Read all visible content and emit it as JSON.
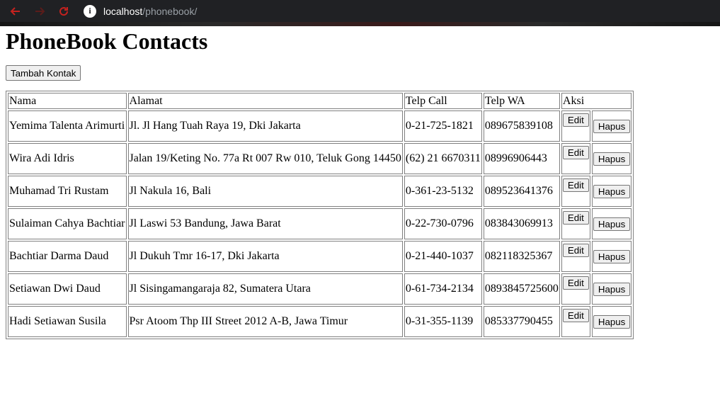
{
  "browser": {
    "url_host": "localhost",
    "url_path": "/phonebook/"
  },
  "page": {
    "title": "PhoneBook Contacts",
    "add_button": "Tambah Kontak"
  },
  "table": {
    "headers": [
      "Nama",
      "Alamat",
      "Telp Call",
      "Telp WA",
      "Aksi"
    ],
    "edit_label": "Edit",
    "delete_label": "Hapus",
    "rows": [
      {
        "nama": "Yemima Talenta Arimurti",
        "alamat": "Jl. Jl Hang Tuah Raya 19, Dki Jakarta",
        "telp_call": "0-21-725-1821",
        "telp_wa": "089675839108"
      },
      {
        "nama": "Wira Adi Idris",
        "alamat": "Jalan 19/Keting No. 77a Rt 007 Rw 010, Teluk Gong 14450",
        "telp_call": "(62) 21 6670311",
        "telp_wa": "08996906443"
      },
      {
        "nama": "Muhamad Tri Rustam",
        "alamat": "Jl Nakula 16, Bali",
        "telp_call": "0-361-23-5132",
        "telp_wa": "089523641376"
      },
      {
        "nama": "Sulaiman Cahya Bachtiar",
        "alamat": "Jl Laswi 53 Bandung, Jawa Barat",
        "telp_call": "0-22-730-0796",
        "telp_wa": "083843069913"
      },
      {
        "nama": "Bachtiar Darma Daud",
        "alamat": "Jl Dukuh Tmr 16-17, Dki Jakarta",
        "telp_call": "0-21-440-1037",
        "telp_wa": "082118325367"
      },
      {
        "nama": "Setiawan Dwi Daud",
        "alamat": "Jl Sisingamangaraja 82, Sumatera Utara",
        "telp_call": "0-61-734-2134",
        "telp_wa": "0893845725600"
      },
      {
        "nama": "Hadi Setiawan Susila",
        "alamat": "Psr Atoom Thp III Street 2012 A-B, Jawa Timur",
        "telp_call": "0-31-355-1139",
        "telp_wa": "085337790455"
      }
    ]
  },
  "colors": {
    "browser_bar": "#202124",
    "nav_icon": "#c5221f",
    "url_host": "#ffffff",
    "url_path": "#9aa0a6"
  }
}
